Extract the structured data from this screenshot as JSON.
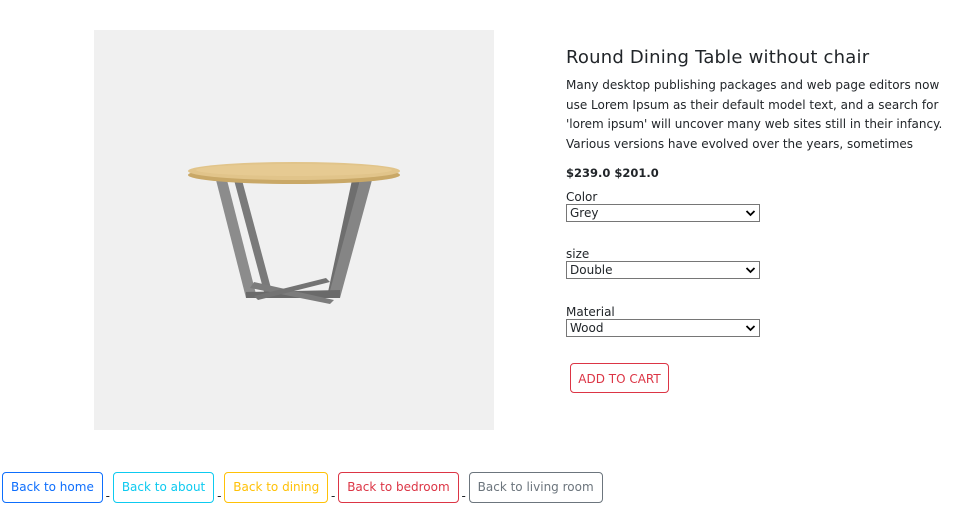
{
  "product": {
    "title": "Round Dining Table without chair",
    "description": "Many desktop publishing packages and web page editors now use Lorem Ipsum as their default model text, and a search for 'lorem ipsum' will uncover many web sites still in their infancy. Various versions have evolved over the years, sometimes",
    "price_original": "$239.0",
    "price_sale": "$201.0",
    "image_icon": "round-table-image"
  },
  "options": {
    "color": {
      "label": "Color",
      "selected": "Grey"
    },
    "size": {
      "label": "size",
      "selected": "Double"
    },
    "material": {
      "label": "Material",
      "selected": "Wood"
    }
  },
  "cart": {
    "label": "ADD TO CART",
    "color": "#dc3545"
  },
  "nav": {
    "separator": "-",
    "links": [
      {
        "label": "Back to home",
        "color": "#0d6efd"
      },
      {
        "label": "Back to about",
        "color": "#0dcaf0"
      },
      {
        "label": "Back to dining",
        "color": "#ffc107"
      },
      {
        "label": "Back to bedroom",
        "color": "#dc3545"
      },
      {
        "label": "Back to living room",
        "color": "#6c757d"
      }
    ]
  }
}
